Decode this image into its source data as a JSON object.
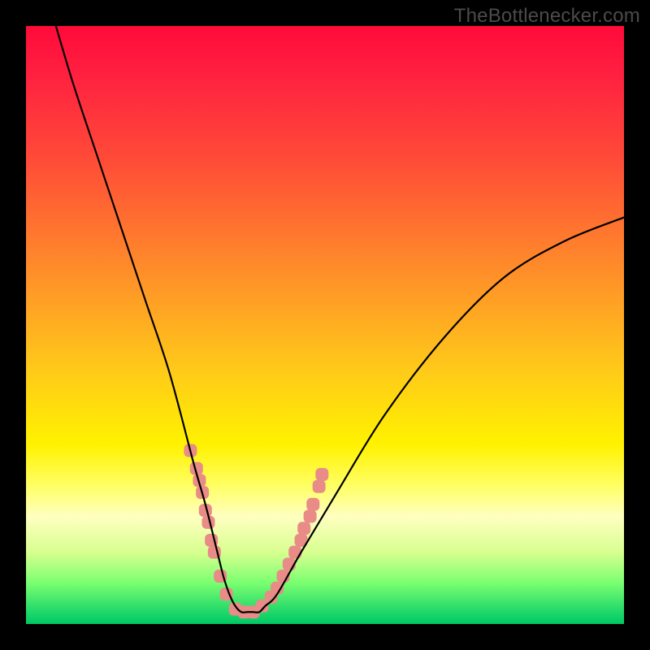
{
  "watermark": "TheBottlenecker.com",
  "chart_data": {
    "type": "line",
    "title": "",
    "xlabel": "",
    "ylabel": "",
    "xlim": [
      0,
      100
    ],
    "ylim": [
      0,
      100
    ],
    "grid": false,
    "series": [
      {
        "name": "bottleneck-curve",
        "color": "#000000",
        "x": [
          5,
          8,
          12,
          16,
          20,
          24,
          28,
          30,
          32,
          33,
          34,
          35,
          36,
          37,
          38,
          39,
          40,
          42,
          46,
          52,
          60,
          70,
          80,
          90,
          100
        ],
        "y": [
          100,
          90,
          78,
          66,
          54,
          42,
          27,
          20,
          12,
          8,
          5,
          3,
          2,
          2,
          2,
          2,
          3,
          5,
          12,
          22,
          35,
          48,
          58,
          64,
          68
        ]
      }
    ],
    "markers": {
      "name": "highlight-dots",
      "color": "#e98b87",
      "radius": 8,
      "points": [
        [
          27.5,
          29
        ],
        [
          28.5,
          26
        ],
        [
          29.0,
          24
        ],
        [
          29.5,
          22
        ],
        [
          30.0,
          19
        ],
        [
          30.5,
          17
        ],
        [
          31.0,
          14
        ],
        [
          31.5,
          12
        ],
        [
          32.5,
          8
        ],
        [
          33.5,
          5
        ],
        [
          35.0,
          2.5
        ],
        [
          36.5,
          2
        ],
        [
          38.0,
          2
        ],
        [
          39.5,
          3
        ],
        [
          41.0,
          4.5
        ],
        [
          42.0,
          6
        ],
        [
          43.0,
          8
        ],
        [
          44.0,
          10
        ],
        [
          45.0,
          12
        ],
        [
          46.0,
          14
        ],
        [
          46.5,
          16
        ],
        [
          47.5,
          18
        ],
        [
          48.0,
          20
        ],
        [
          49.0,
          23
        ],
        [
          49.5,
          25
        ]
      ]
    },
    "background_gradient": {
      "top": "#ff0a3a",
      "mid": "#fff200",
      "bottom": "#00c864"
    }
  }
}
